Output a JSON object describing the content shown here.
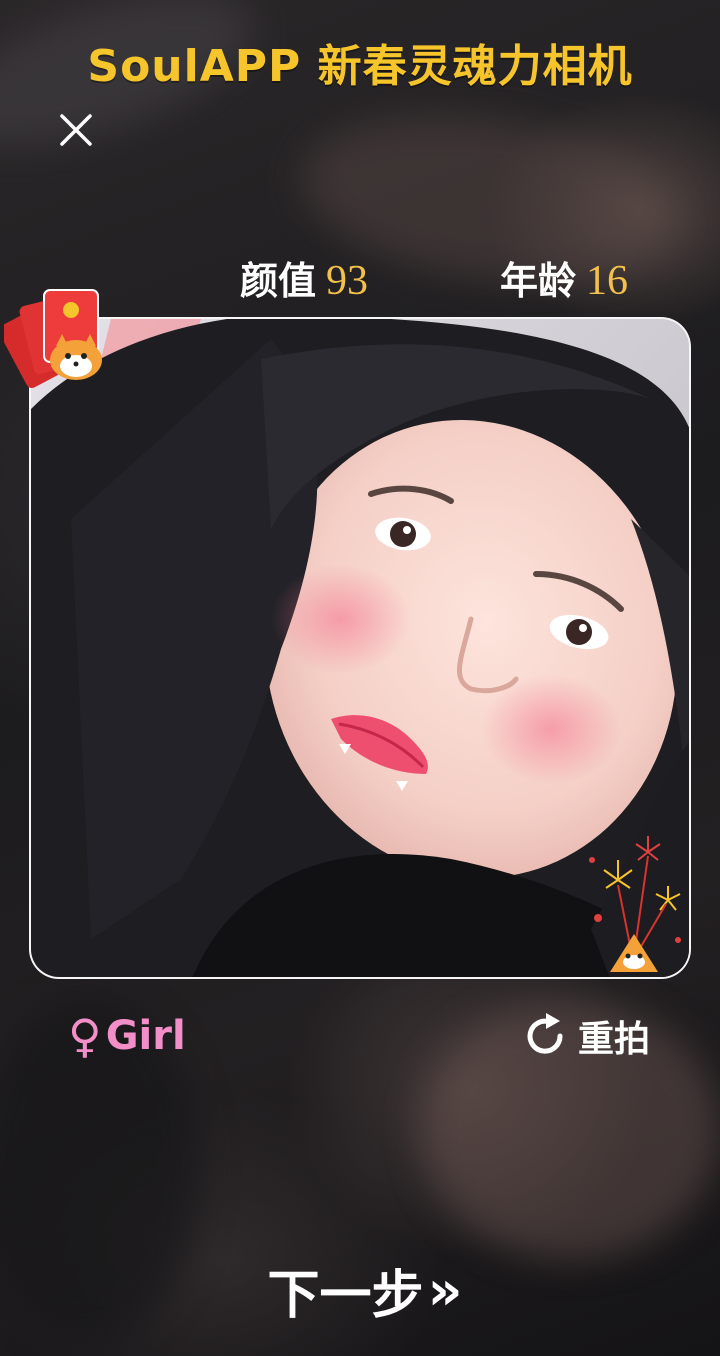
{
  "header": {
    "title": "SoulAPP 新春灵魂力相机"
  },
  "toolbar": {
    "close_icon": "close-icon"
  },
  "scores": {
    "beauty_label": "颜值",
    "beauty_value": "93",
    "age_label": "年龄",
    "age_value": "16"
  },
  "photo": {
    "subject": "selfie-photo",
    "stickers": [
      "red-envelope-shiba-sticker",
      "fireworks-shiba-sticker"
    ]
  },
  "result": {
    "gender_symbol": "♀",
    "gender_label": "Girl",
    "retake_label": "重拍",
    "retake_icon": "refresh-icon"
  },
  "footer": {
    "next_label": "下一步",
    "next_arrows": "»"
  },
  "colors": {
    "title": "#f6c42b",
    "score_value": "#f2c04b",
    "gender": "#f28ec8",
    "text": "#ffffff"
  }
}
